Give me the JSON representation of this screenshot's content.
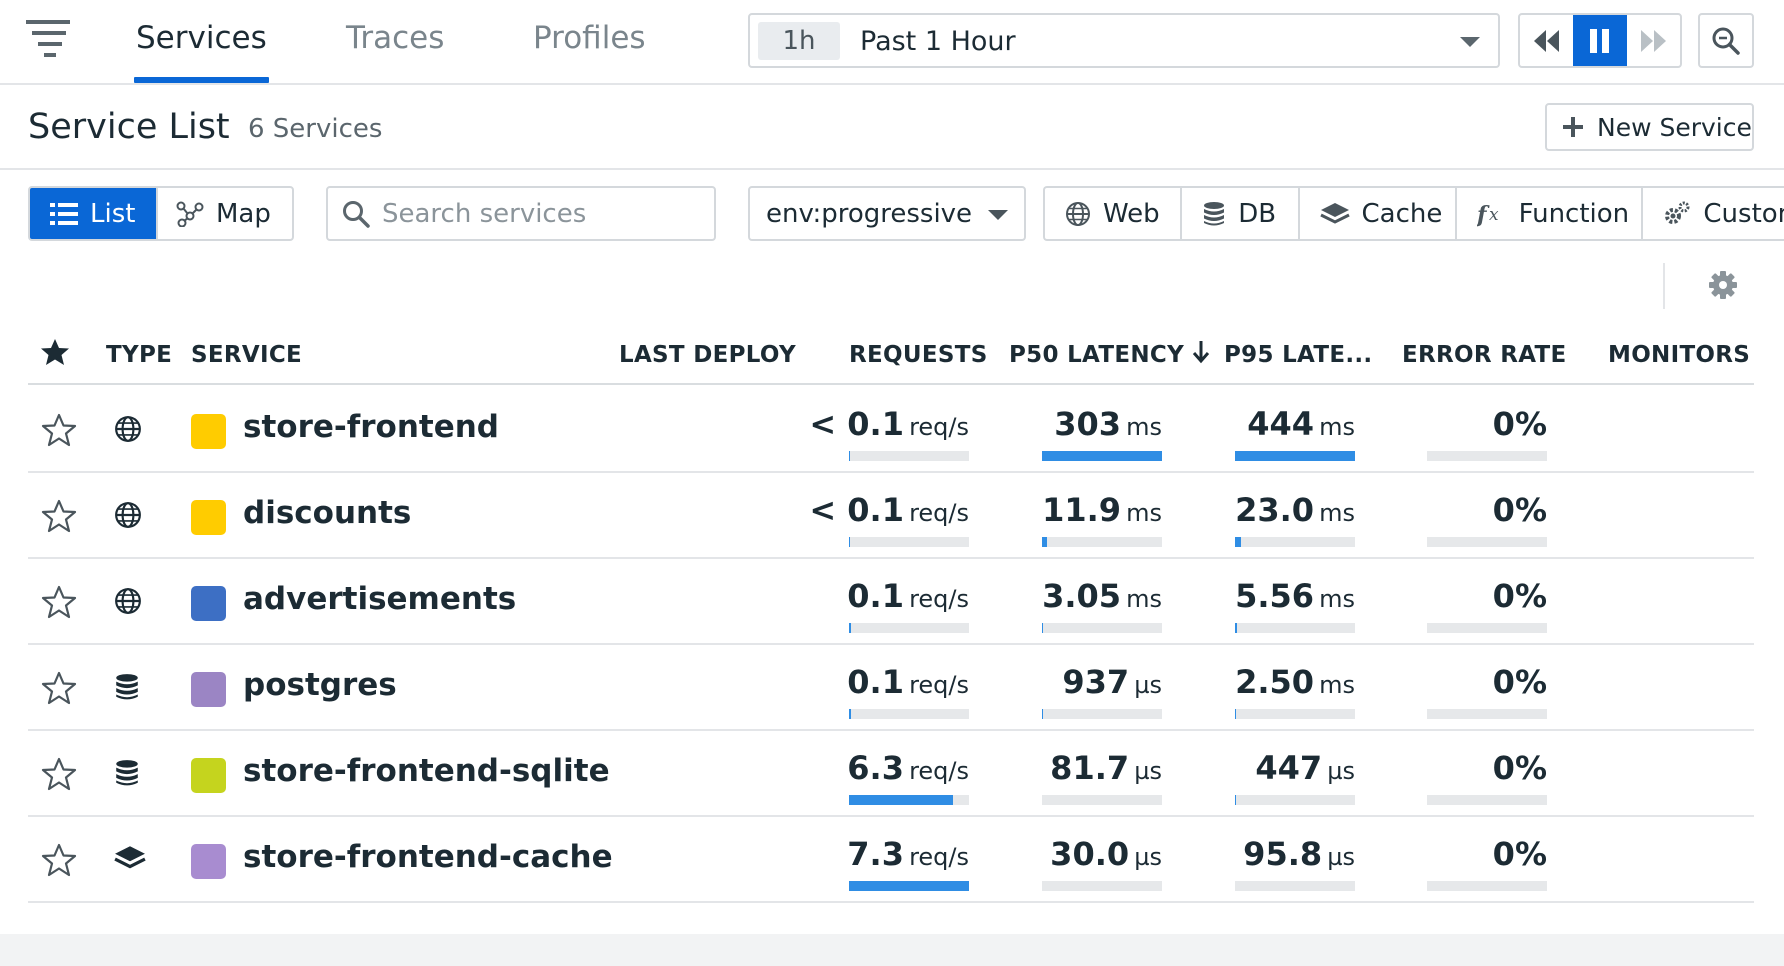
{
  "nav": {
    "tabs": [
      {
        "label": "Services",
        "active": true
      },
      {
        "label": "Traces",
        "active": false
      },
      {
        "label": "Profiles",
        "active": false
      }
    ],
    "timepicker": {
      "badge": "1h",
      "label": "Past 1 Hour"
    },
    "playback": {
      "paused": true
    }
  },
  "header": {
    "title": "Service List",
    "count": "6 Services",
    "new_service_label": "New Service"
  },
  "filters": {
    "view_list_label": "List",
    "view_map_label": "Map",
    "active_view": "List",
    "search_placeholder": "Search services",
    "search_value": "",
    "env_value": "env:progressive",
    "types": [
      {
        "label": "Web",
        "icon": "globe-icon"
      },
      {
        "label": "DB",
        "icon": "database-icon"
      },
      {
        "label": "Cache",
        "icon": "layers-icon"
      },
      {
        "label": "Function",
        "icon": "function-icon"
      },
      {
        "label": "Custom",
        "icon": "gears-icon"
      }
    ]
  },
  "table": {
    "columns": {
      "type": "TYPE",
      "service": "SERVICE",
      "last_deploy": "LAST DEPLOY",
      "requests": "REQUESTS",
      "p50": "P50 LATENCY",
      "p95": "P95 LATE...",
      "error_rate": "ERROR RATE",
      "monitors": "MONITORS"
    },
    "sort": {
      "column": "p95",
      "direction": "desc"
    },
    "rows": [
      {
        "name": "store-frontend",
        "type_icon": "globe-icon",
        "color": "#ffcc00",
        "requests": {
          "prefix": "< ",
          "value": "0.1",
          "unit": "req/s",
          "bar": 0.01
        },
        "p50": {
          "value": "303",
          "unit": "ms",
          "bar": 1.0
        },
        "p95": {
          "value": "444",
          "unit": "ms",
          "bar": 1.0
        },
        "error_rate": {
          "value": "0%",
          "bar": 0.0
        }
      },
      {
        "name": "discounts",
        "type_icon": "globe-icon",
        "color": "#ffcc00",
        "requests": {
          "prefix": "< ",
          "value": "0.1",
          "unit": "req/s",
          "bar": 0.01
        },
        "p50": {
          "value": "11.9",
          "unit": "ms",
          "bar": 0.039
        },
        "p95": {
          "value": "23.0",
          "unit": "ms",
          "bar": 0.052
        },
        "error_rate": {
          "value": "0%",
          "bar": 0.0
        }
      },
      {
        "name": "advertisements",
        "type_icon": "globe-icon",
        "color": "#3d6fc4",
        "requests": {
          "prefix": "",
          "value": "0.1",
          "unit": "req/s",
          "bar": 0.014
        },
        "p50": {
          "value": "3.05",
          "unit": "ms",
          "bar": 0.01
        },
        "p95": {
          "value": "5.56",
          "unit": "ms",
          "bar": 0.013
        },
        "error_rate": {
          "value": "0%",
          "bar": 0.0
        }
      },
      {
        "name": "postgres",
        "type_icon": "database-icon",
        "color": "#9b85c4",
        "requests": {
          "prefix": "",
          "value": "0.1",
          "unit": "req/s",
          "bar": 0.014
        },
        "p50": {
          "value": "937",
          "unit": "µs",
          "bar": 0.003
        },
        "p95": {
          "value": "2.50",
          "unit": "ms",
          "bar": 0.006
        },
        "error_rate": {
          "value": "0%",
          "bar": 0.0
        }
      },
      {
        "name": "store-frontend-sqlite",
        "type_icon": "database-icon",
        "color": "#c5d41e",
        "requests": {
          "prefix": "",
          "value": "6.3",
          "unit": "req/s",
          "bar": 0.863
        },
        "p50": {
          "value": "81.7",
          "unit": "µs",
          "bar": 0.0
        },
        "p95": {
          "value": "447",
          "unit": "µs",
          "bar": 0.001
        },
        "error_rate": {
          "value": "0%",
          "bar": 0.0
        }
      },
      {
        "name": "store-frontend-cache",
        "type_icon": "layers-icon",
        "color": "#a88cd0",
        "requests": {
          "prefix": "",
          "value": "7.3",
          "unit": "req/s",
          "bar": 1.0
        },
        "p50": {
          "value": "30.0",
          "unit": "µs",
          "bar": 0.0
        },
        "p95": {
          "value": "95.8",
          "unit": "µs",
          "bar": 0.0
        },
        "error_rate": {
          "value": "0%",
          "bar": 0.0
        }
      }
    ]
  },
  "colors": {
    "accent": "#0a67d6",
    "bar_fill": "#2f8de4",
    "bar_track": "#e6e8ea"
  }
}
